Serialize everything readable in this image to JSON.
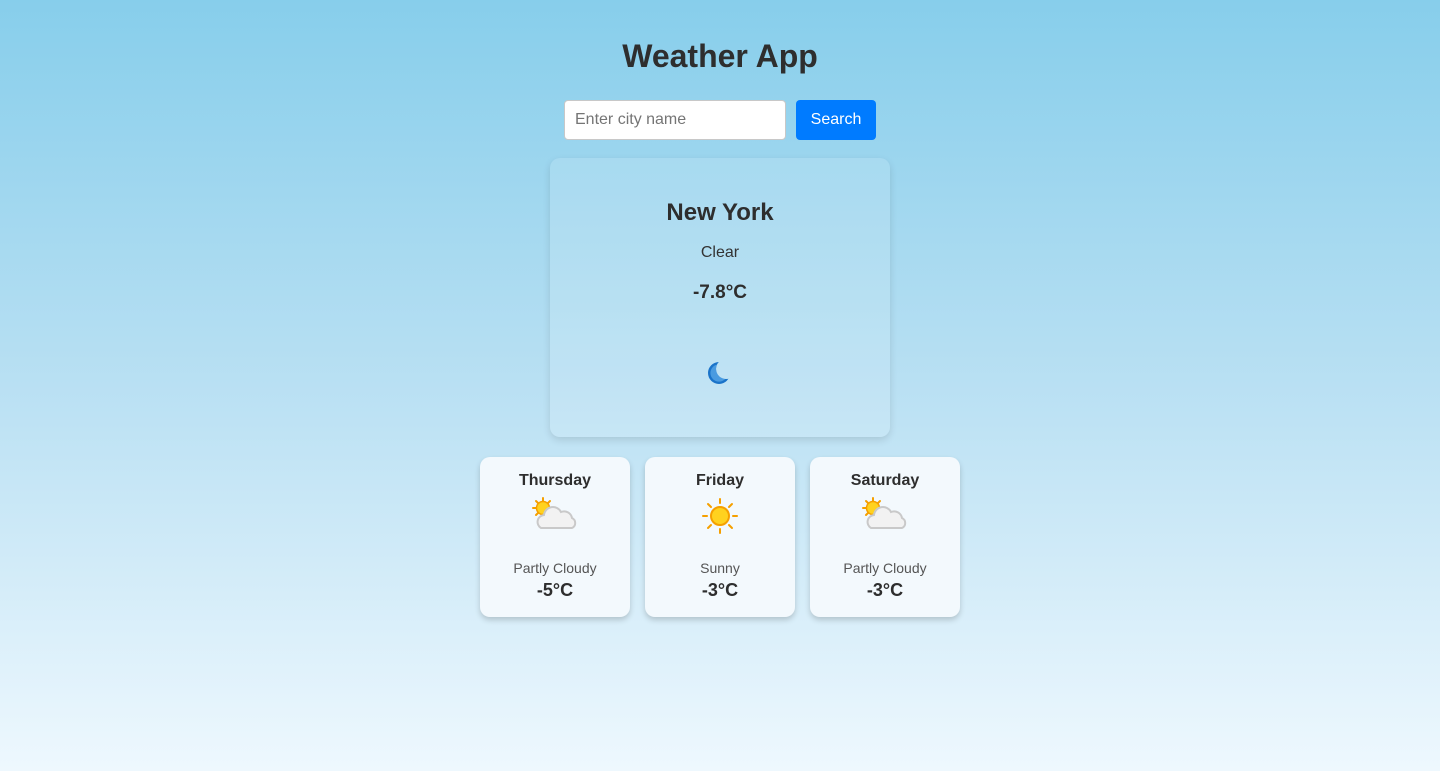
{
  "app": {
    "title": "Weather App"
  },
  "search": {
    "placeholder": "Enter city name",
    "value": "",
    "button_label": "Search"
  },
  "current": {
    "city": "New York",
    "condition": "Clear",
    "temperature": "-7.8°C",
    "icon": "moon-icon"
  },
  "forecast": [
    {
      "day": "Thursday",
      "condition": "Partly Cloudy",
      "temperature": "-5°C",
      "icon": "partly-cloudy-icon"
    },
    {
      "day": "Friday",
      "condition": "Sunny",
      "temperature": "-3°C",
      "icon": "sun-icon"
    },
    {
      "day": "Saturday",
      "condition": "Partly Cloudy",
      "temperature": "-3°C",
      "icon": "partly-cloudy-icon"
    }
  ],
  "colors": {
    "accent": "#007bff",
    "background_top": "#87ceeb",
    "background_bottom": "#eef8fe"
  }
}
